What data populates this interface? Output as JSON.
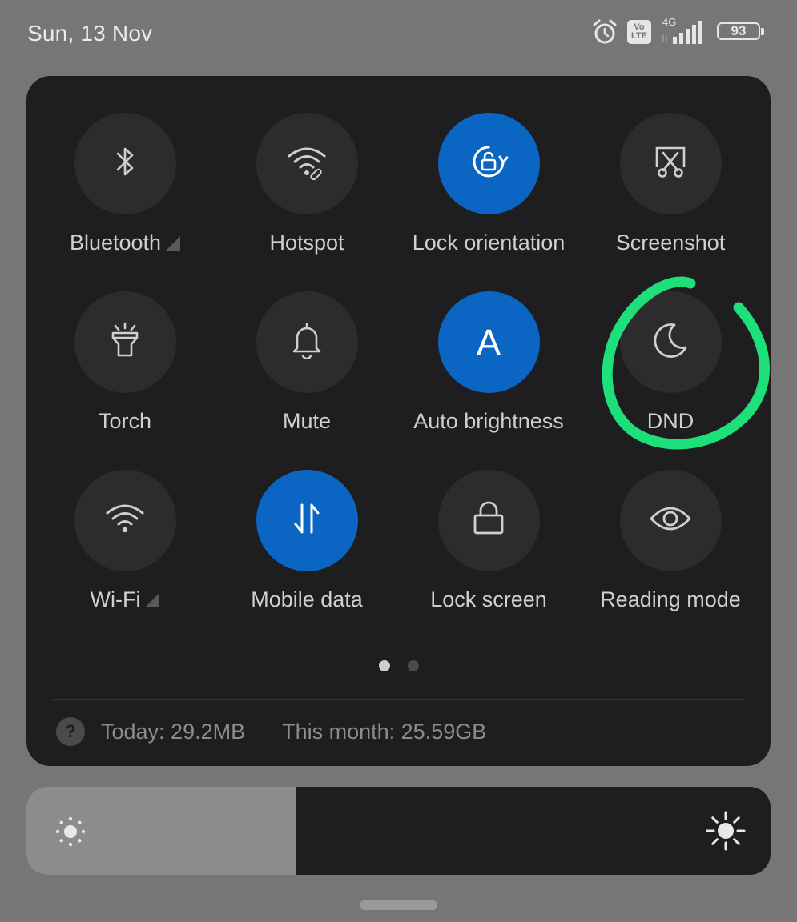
{
  "status_bar": {
    "date": "Sun, 13 Nov",
    "volte_top": "Vo",
    "volte_bottom": "LTE",
    "network_type": "4G",
    "battery_level": "93",
    "icons": [
      "alarm-icon",
      "volte-icon",
      "signal-icon",
      "battery-icon"
    ]
  },
  "quick_settings": {
    "tiles": [
      {
        "label": "Bluetooth",
        "icon": "bluetooth-icon",
        "active": false,
        "has_more": true
      },
      {
        "label": "Hotspot",
        "icon": "hotspot-icon",
        "active": false,
        "has_more": false
      },
      {
        "label": "Lock orientation",
        "icon": "lock-rotation-icon",
        "active": true,
        "has_more": false
      },
      {
        "label": "Screenshot",
        "icon": "screenshot-icon",
        "active": false,
        "has_more": false
      },
      {
        "label": "Torch",
        "icon": "torch-icon",
        "active": false,
        "has_more": false
      },
      {
        "label": "Mute",
        "icon": "bell-icon",
        "active": false,
        "has_more": false
      },
      {
        "label": "Auto brightness",
        "icon": "auto-brightness-icon",
        "icon_text": "A",
        "active": true,
        "has_more": false
      },
      {
        "label": "DND",
        "icon": "moon-icon",
        "active": false,
        "has_more": false
      },
      {
        "label": "Wi-Fi",
        "icon": "wifi-icon",
        "active": false,
        "has_more": true
      },
      {
        "label": "Mobile data",
        "icon": "mobile-data-icon",
        "active": true,
        "has_more": false
      },
      {
        "label": "Lock screen",
        "icon": "padlock-icon",
        "active": false,
        "has_more": false
      },
      {
        "label": "Reading mode",
        "icon": "eye-icon",
        "active": false,
        "has_more": false
      }
    ],
    "page_count": 2,
    "current_page": 1
  },
  "data_usage": {
    "help_symbol": "?",
    "today": "Today: 29.2MB",
    "month": "This month: 25.59GB"
  },
  "brightness": {
    "level": 0.362
  },
  "colors": {
    "background": "#767676",
    "panel": "#1e1e20",
    "tile_off": "#2c2c2e",
    "tile_on": "#0a66c2",
    "annotation": "#1ee07a"
  }
}
